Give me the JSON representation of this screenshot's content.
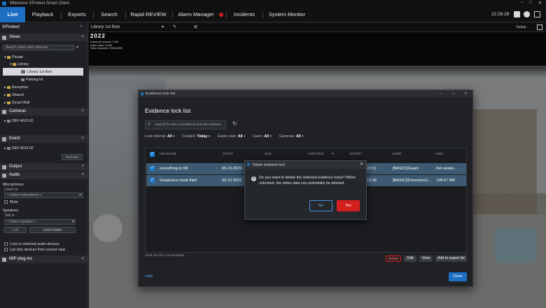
{
  "window": {
    "title": "Milestone XProtect Smart Client",
    "controls": [
      "–",
      "□",
      "✕"
    ]
  },
  "nav": {
    "tabs": [
      "Live",
      "Playback",
      "Exports",
      "Search",
      "Rapid REVIEW",
      "Alarm Manager",
      "Incidents",
      "System Monitor"
    ],
    "clock": "22:26:29"
  },
  "sidebar": {
    "title": "XProtect",
    "views": {
      "header": "Views",
      "search_placeholder": "Search views and cameras...",
      "items": [
        "Private",
        "Library",
        "Library 1st floor",
        "Parking lot",
        "Reception",
        "Shared",
        "Smart Wall"
      ]
    },
    "cameras": {
      "header": "Cameras",
      "item": "DEF-MU3-02"
    },
    "events": {
      "header": "Event",
      "item": "DEF-MU3-02",
      "activate": "Activate"
    },
    "output": {
      "header": "Output"
    },
    "audio": {
      "header": "Audio",
      "microphones": "Microphones",
      "listen_to": "Listen to",
      "mic_select": "< Select microphone >",
      "mute": "Mute",
      "speakers": "Speakers",
      "talk_to": "Talk to",
      "speaker_select": "< Select speaker >",
      "talk": "Talk",
      "level": "Level meter",
      "lock": "Lock to selected audio devices",
      "list_only": "List only devices from current view"
    },
    "mip": {
      "header": "MIP plug-ins"
    }
  },
  "video_header": {
    "view_name": "Library 1st floor",
    "setup": "Setup"
  },
  "overlay": {
    "cam_title": "2022",
    "lines": [
      "Frame per second: 7.034",
      "Video codec: H.264",
      "Video resolution: 1920x1080"
    ]
  },
  "evidence": {
    "window_title": "Evidence lock list",
    "title": "Evidence lock list",
    "search_placeholder": "Search for text in headlines and descriptions",
    "filters": [
      {
        "label": "Lock interval:",
        "value": "All"
      },
      {
        "label": "Created:",
        "value": "Today"
      },
      {
        "label": "Expiry date:",
        "value": "All"
      },
      {
        "label": "Users:",
        "value": "All"
      },
      {
        "label": "Cameras:",
        "value": "All"
      }
    ],
    "columns": [
      "Headline",
      "Start",
      "End",
      "Created",
      "Expiry",
      "User",
      "Size"
    ],
    "rows": [
      {
        "headline": "everything is OK",
        "start": "05-10-2022 ...",
        "expiry": "...4 22:23:11",
        "user": "[BASIC]\\Guard",
        "size": "Not availa..."
      },
      {
        "headline": "Suspicious book thief",
        "start": "05-10-2022 ...",
        "expiry": "...4 22:13:36",
        "user": "[BASIC]\\ForensicsU...",
        "size": "138.67 MB"
      }
    ],
    "footer_note": "Total 1st size not available.",
    "buttons": {
      "delete": "Delete",
      "edit": "Edit",
      "view": "View",
      "export": "Add to export list"
    },
    "help": "Help",
    "close": "Close"
  },
  "confirm": {
    "title": "Delete evidence lock",
    "message": "Do you want to delete the selected evidence locks? When unlocked, the video data can potentially be deleted.",
    "no": "No",
    "yes": "Yes"
  },
  "colors": {
    "accent": "#1b6ec2",
    "danger": "#d41f1f",
    "row_selected": "#3d5a72",
    "checkbox": "#1b7fd4"
  }
}
